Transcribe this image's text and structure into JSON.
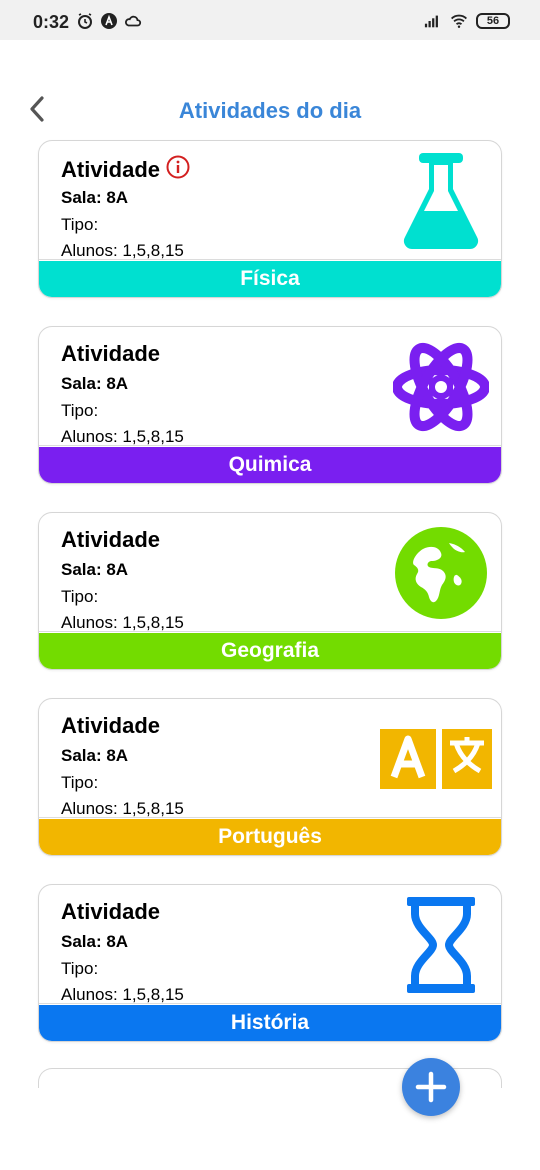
{
  "status_bar": {
    "time": "0:32",
    "battery": "56",
    "icons_left": [
      "alarm-icon",
      "app-icon",
      "cloud-icon"
    ],
    "icons_right": [
      "signal-icon",
      "wifi-icon",
      "battery-icon"
    ]
  },
  "header": {
    "title": "Atividades do dia",
    "back_icon": "chevron-left-icon"
  },
  "activities": [
    {
      "title": "Atividade",
      "sala": "Sala: 8A",
      "tipo": "Tipo:",
      "alunos": "Alunos: 1,5,8,15",
      "subject": "Física",
      "color": "#00e0d0",
      "icon": "flask-icon",
      "alert": true
    },
    {
      "title": "Atividade",
      "sala": "Sala: 8A",
      "tipo": "Tipo:",
      "alunos": "Alunos: 1,5,8,15",
      "subject": "Quimica",
      "color": "#7a1ff0",
      "icon": "atom-icon",
      "alert": false
    },
    {
      "title": "Atividade",
      "sala": "Sala: 8A",
      "tipo": "Tipo:",
      "alunos": "Alunos: 1,5,8,15",
      "subject": "Geografia",
      "color": "#73dc00",
      "icon": "globe-icon",
      "alert": false
    },
    {
      "title": "Atividade",
      "sala": "Sala: 8A",
      "tipo": "Tipo:",
      "alunos": "Alunos: 1,5,8,15",
      "subject": "Português",
      "color": "#f2b600",
      "icon": "translate-icon",
      "alert": false
    },
    {
      "title": "Atividade",
      "sala": "Sala: 8A",
      "tipo": "Tipo:",
      "alunos": "Alunos: 1,5,8,15",
      "subject": "História",
      "color": "#0a77f0",
      "icon": "hourglass-icon",
      "alert": false
    }
  ],
  "fab": {
    "icon": "plus-icon",
    "color": "#3b82df"
  },
  "colors": {
    "title": "#3a86d8",
    "alert": "#d32020"
  }
}
